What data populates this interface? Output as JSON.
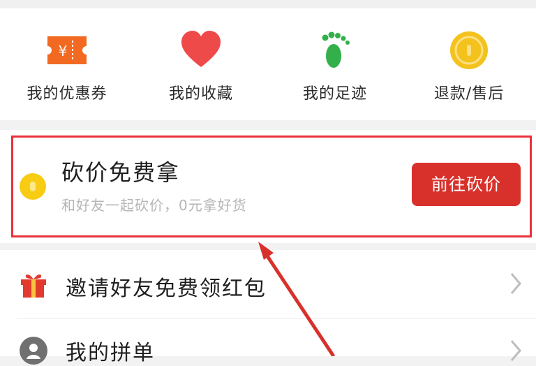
{
  "quick_actions": [
    {
      "label": "我的优惠券",
      "icon": "coupon-icon"
    },
    {
      "label": "我的收藏",
      "icon": "heart-icon"
    },
    {
      "label": "我的足迹",
      "icon": "footprint-icon"
    },
    {
      "label": "退款/售后",
      "icon": "refund-coin-icon"
    }
  ],
  "bargain": {
    "title": "砍价免费拿",
    "subtitle": "和好友一起砍价，0元拿好货",
    "button_label": "前往砍价",
    "icon": "coin-icon"
  },
  "list_items": [
    {
      "label": "邀请好友免费领红包",
      "icon": "gift-icon"
    },
    {
      "label": "我的拼单",
      "icon": "group-icon"
    }
  ],
  "colors": {
    "accent": "#d8312b",
    "highlight_border": "#e8323c",
    "coupon": "#f26a21",
    "heart": "#ef4a4a",
    "footprint": "#33b04a",
    "coin": "#f7cc12"
  }
}
